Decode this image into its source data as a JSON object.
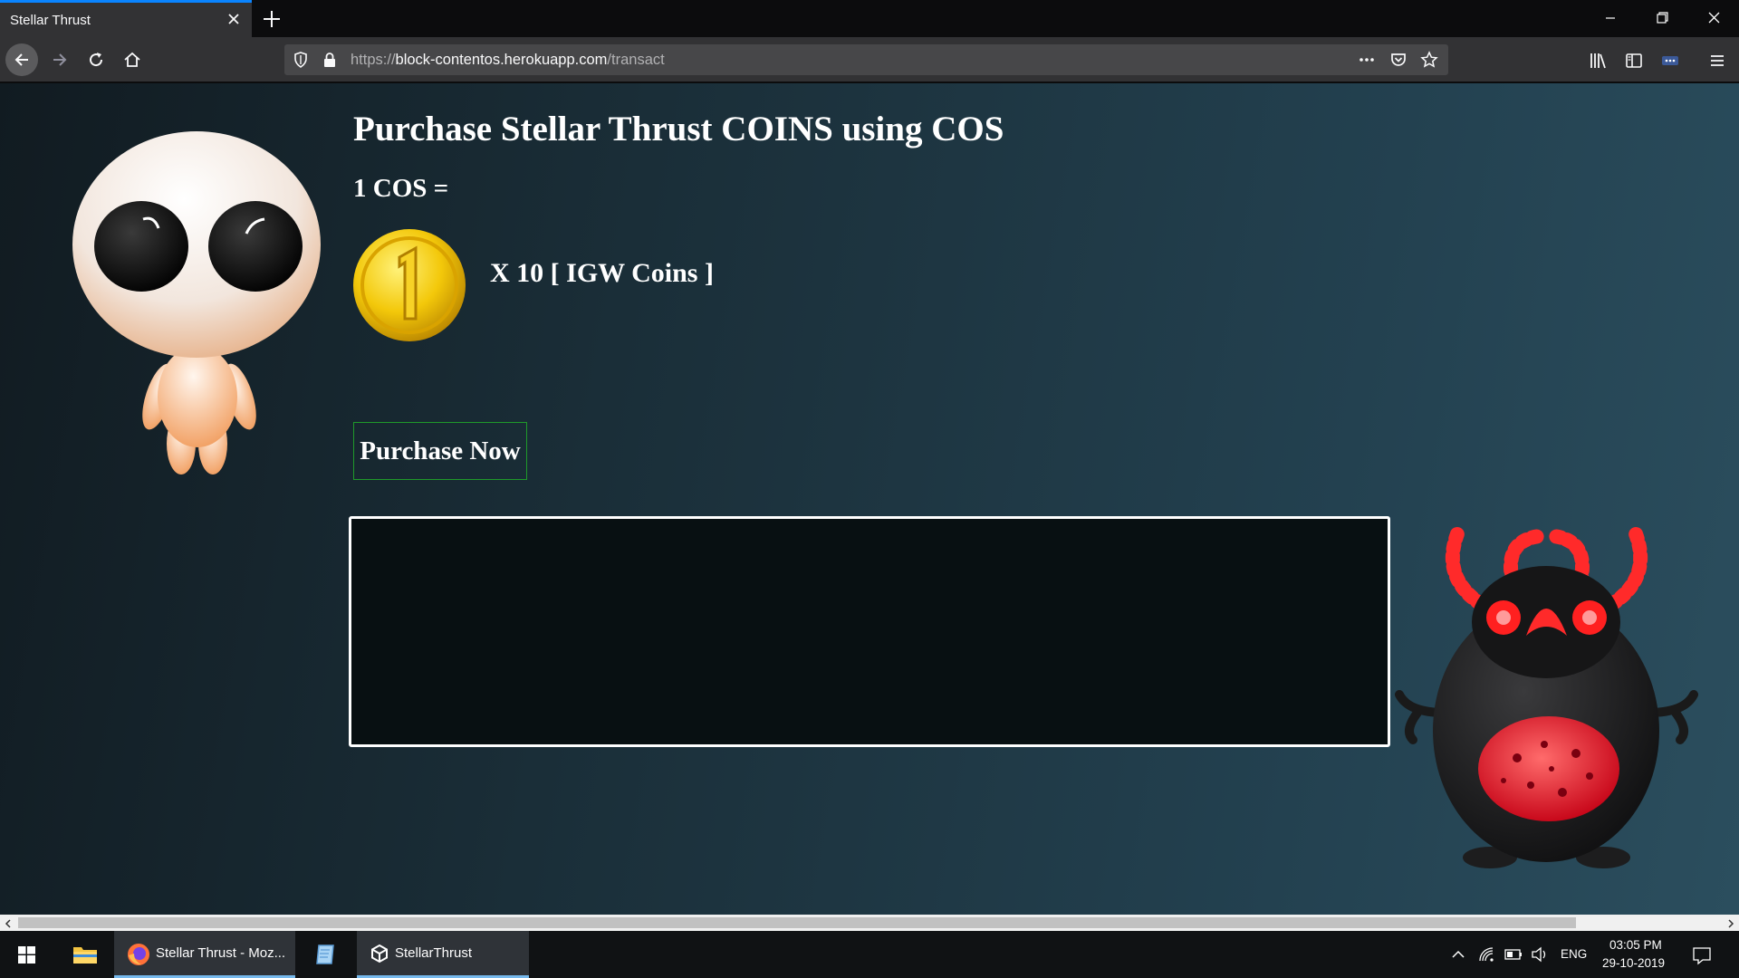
{
  "browser": {
    "tab_title": "Stellar Thrust",
    "url_scheme": "https://",
    "url_host": "block-contentos.herokuapp.com",
    "url_path": "/transact"
  },
  "page": {
    "heading": "Purchase Stellar Thrust COINS using COS",
    "rate_prefix": "1 COS =",
    "rate_value": "X 10 [ IGW Coins ]",
    "purchase_button": "Purchase Now",
    "colors": {
      "button_border": "#1f9a2a",
      "background_dark": "#111b21",
      "background_light": "#2b4e5e"
    }
  },
  "icons": {
    "coin": "gold-coin-icon",
    "character_left": "white-creature-character",
    "character_right": "black-red-monster-character"
  },
  "taskbar": {
    "items": [
      {
        "label": "Stellar Thrust - Moz..."
      },
      {
        "label": "StellarThrust"
      }
    ],
    "language": "ENG",
    "time": "03:05 PM",
    "date": "29-10-2019"
  }
}
